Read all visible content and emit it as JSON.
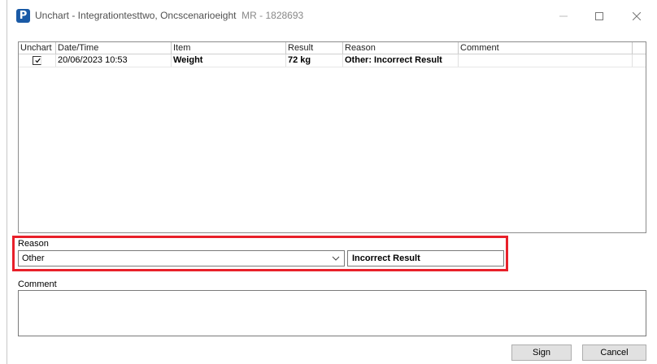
{
  "window": {
    "app_icon_letter": "P",
    "title": "Unchart - Integrationtesttwo, Oncscenarioeight",
    "mr": "MR - 1828693",
    "controls": {
      "minimize": "—",
      "maximize": "☐",
      "close": "✕"
    }
  },
  "grid": {
    "headers": [
      "Unchart",
      "Date/Time",
      "Item",
      "Result",
      "Reason",
      "Comment"
    ],
    "rows": [
      {
        "unchart_checked": true,
        "checkmark": "✓",
        "datetime": "20/06/2023 10:53",
        "item": "Weight",
        "result": "72 kg",
        "reason": "Other: Incorrect Result",
        "comment": ""
      }
    ]
  },
  "reason": {
    "label": "Reason",
    "selected": "Other",
    "detail": "Incorrect Result"
  },
  "comment": {
    "label": "Comment",
    "value": ""
  },
  "buttons": {
    "sign": "Sign",
    "cancel": "Cancel"
  },
  "colors": {
    "highlight_border": "#e8202a",
    "app_icon": "#1a5aa6"
  }
}
